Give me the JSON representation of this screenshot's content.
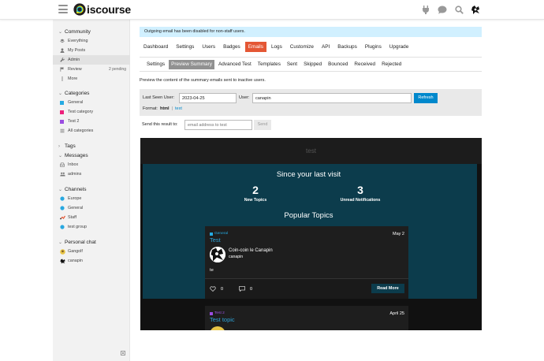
{
  "header": {
    "logo_text": "iscourse",
    "icons": [
      "plug-icon",
      "chat-icon",
      "search-icon",
      "user-avatar"
    ]
  },
  "notice": "Outgoing email has been disabled for non-staff users.",
  "sidebar": {
    "community": {
      "label": "Community",
      "items": [
        {
          "label": "Everything",
          "icon": "layers-icon"
        },
        {
          "label": "My Posts",
          "icon": "user-icon"
        },
        {
          "label": "Admin",
          "icon": "wrench-icon",
          "active": true
        },
        {
          "label": "Review",
          "icon": "flag-icon",
          "badge": "2 pending"
        },
        {
          "label": "More",
          "icon": "ellipsis-icon"
        }
      ]
    },
    "categories": {
      "label": "Categories",
      "items": [
        {
          "label": "General",
          "color": "#25aae2"
        },
        {
          "label": "Test category",
          "color": "#ed207b"
        },
        {
          "label": "Test 2",
          "color": "#9b4de1"
        },
        {
          "label": "All categories",
          "icon": "list-icon"
        }
      ]
    },
    "tags": {
      "label": "Tags"
    },
    "messages": {
      "label": "Messages",
      "items": [
        {
          "label": "Inbox",
          "icon": "inbox-icon"
        },
        {
          "label": "admins",
          "icon": "group-icon"
        }
      ]
    },
    "channels": {
      "label": "Channels",
      "items": [
        {
          "label": "Europe",
          "icon": "hash-icon"
        },
        {
          "label": "General",
          "icon": "hash-icon"
        },
        {
          "label": "Staff",
          "icon": "shield-icon"
        },
        {
          "label": "test group",
          "icon": "hash-icon"
        }
      ]
    },
    "personal_chat": {
      "label": "Personal chat",
      "items": [
        {
          "label": "Gangolf",
          "icon": "avatar-icon"
        },
        {
          "label": "canapin",
          "icon": "avatar-icon"
        }
      ]
    }
  },
  "admin_nav": [
    "Dashboard",
    "Settings",
    "Users",
    "Badges",
    "Emails",
    "Logs",
    "Customize",
    "API",
    "Backups",
    "Plugins",
    "Upgrade"
  ],
  "admin_nav_active": "Emails",
  "sub_nav": [
    "Settings",
    "Preview Summary",
    "Advanced Test",
    "Templates",
    "Sent",
    "Skipped",
    "Bounced",
    "Received",
    "Rejected"
  ],
  "sub_nav_active": "Preview Summary",
  "description": "Preview the content of the summary emails sent to inactive users.",
  "filters": {
    "last_seen_label": "Last Seen User:",
    "last_seen_value": "2023-04-25",
    "user_label": "User:",
    "user_value": "canapin",
    "refresh_label": "Refresh",
    "format_label": "Format:",
    "format_html": "html",
    "format_sep": "|",
    "format_text": "text"
  },
  "send": {
    "label": "Send this result to:",
    "placeholder": "email address to test",
    "button": "Send"
  },
  "preview": {
    "site_title": "test",
    "since_title": "Since your last visit",
    "stats": [
      {
        "value": "2",
        "label": "New Topics"
      },
      {
        "value": "3",
        "label": "Unread Notifications"
      }
    ],
    "popular_title": "Popular Topics",
    "topics": [
      {
        "category": "General",
        "category_color": "#25aae2",
        "title": "Test",
        "date": "May 2",
        "post_title": "Coin-coin le Canapin",
        "post_user": "canapin",
        "body": "te",
        "likes": "0",
        "replies": "0",
        "read_more": "Read More"
      },
      {
        "category": "Test 2",
        "category_color": "#9b4de1",
        "title": "Test topic",
        "date": "April 25"
      }
    ]
  }
}
